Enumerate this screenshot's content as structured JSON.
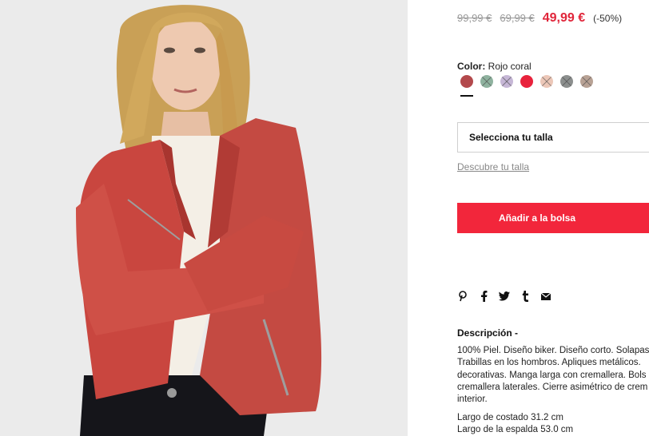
{
  "product": {
    "image_alt": "",
    "prices": {
      "original_1": "99,99 €",
      "original_2": "69,99 €",
      "current": "49,99 €",
      "discount": "(-50%)"
    },
    "color": {
      "label": "Color:",
      "selected": "Rojo coral",
      "swatches": [
        {
          "name": "rojo-coral",
          "hex": "#b3494c",
          "available": true
        },
        {
          "name": "verde",
          "hex": "#8fb29f",
          "available": false
        },
        {
          "name": "lila",
          "hex": "#c6b7d6",
          "available": false
        },
        {
          "name": "rojo",
          "hex": "#e8223c",
          "available": true
        },
        {
          "name": "rosa",
          "hex": "#ecc7b8",
          "available": false
        },
        {
          "name": "gris",
          "hex": "#8c8f8e",
          "available": false
        },
        {
          "name": "topo",
          "hex": "#b8a295",
          "available": false
        }
      ]
    },
    "size": {
      "select_label": "Selecciona tu talla",
      "guide_link": "Descubre tu talla"
    },
    "add_to_bag": "Añadir a la bolsa",
    "share_icons": [
      "pinterest-icon",
      "facebook-icon",
      "twitter-icon",
      "tumblr-icon",
      "email-icon"
    ],
    "description": {
      "title": "Descripción  -",
      "lines": [
        "100% Piel. Diseño biker. Diseño corto. Solapas",
        "Trabillas en los hombros. Apliques metálicos.",
        "decorativas. Manga larga con cremallera. Bols",
        "cremallera laterales. Cierre asimétrico de crem",
        "interior."
      ],
      "measures": [
        "Largo de costado 31.2 cm",
        "Largo de la espalda 53.0 cm"
      ]
    },
    "colors": {
      "accent": "#f2263b",
      "price_sale": "#e0253a"
    }
  }
}
